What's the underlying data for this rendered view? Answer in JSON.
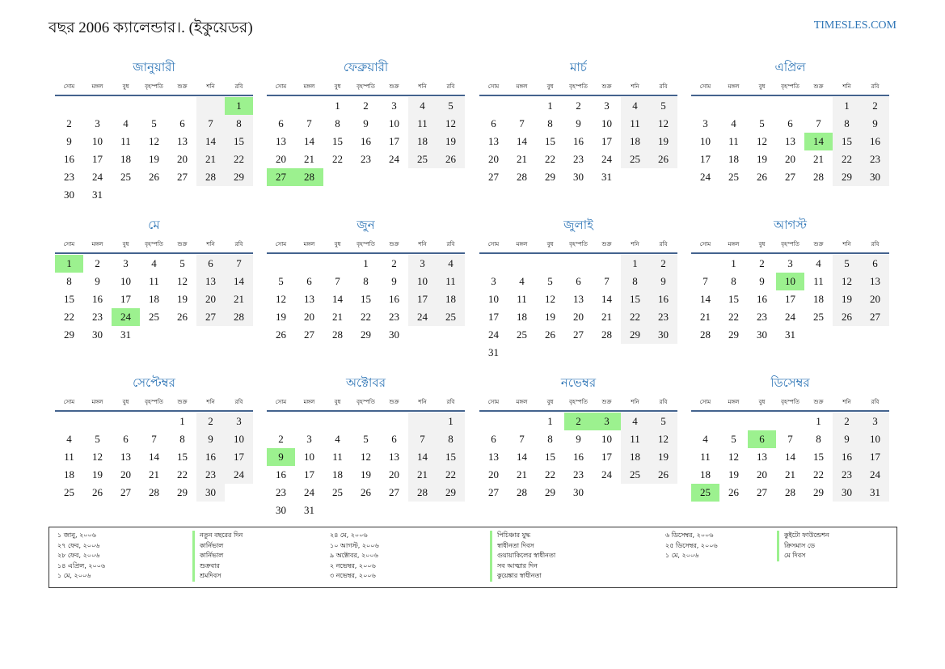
{
  "header": {
    "title": "বছর 2006 ক্যালেন্ডার।. (ইকুয়েডর)",
    "site": "TIMESLES.COM"
  },
  "weekdays": [
    "সোম",
    "মঙ্গল",
    "বুধ",
    "বৃহস্পতি",
    "শুক্র",
    "শনি",
    "রবি"
  ],
  "colors": {
    "accent": "#2e75b6",
    "holiday": "#9cf18f",
    "weekend": "#f2f2f2"
  },
  "months": [
    {
      "name": "জানুয়ারী",
      "offset": 6,
      "days": 31,
      "holidays": [
        1
      ]
    },
    {
      "name": "ফেব্রুয়ারী",
      "offset": 2,
      "days": 28,
      "holidays": [
        27,
        28
      ]
    },
    {
      "name": "মার্চ",
      "offset": 2,
      "days": 31,
      "holidays": []
    },
    {
      "name": "এপ্রিল",
      "offset": 5,
      "days": 30,
      "holidays": [
        14
      ]
    },
    {
      "name": "মে",
      "offset": 0,
      "days": 31,
      "holidays": [
        1,
        24
      ]
    },
    {
      "name": "জুন",
      "offset": 3,
      "days": 30,
      "holidays": []
    },
    {
      "name": "জুলাই",
      "offset": 5,
      "days": 31,
      "holidays": []
    },
    {
      "name": "আগস্ট",
      "offset": 1,
      "days": 31,
      "holidays": [
        10
      ]
    },
    {
      "name": "সেপ্টেম্বর",
      "offset": 4,
      "days": 30,
      "holidays": []
    },
    {
      "name": "অক্টোবর",
      "offset": 6,
      "days": 31,
      "holidays": [
        9
      ]
    },
    {
      "name": "নভেম্বর",
      "offset": 2,
      "days": 30,
      "holidays": [
        2,
        3
      ]
    },
    {
      "name": "ডিসেম্বর",
      "offset": 4,
      "days": 31,
      "holidays": [
        6,
        25
      ]
    }
  ],
  "legend": [
    [
      {
        "date": "১ জানু, ২০০৬",
        "name": "নতুন বছরের দিন"
      },
      {
        "date": "২৭ ফেব, ২০০৬",
        "name": "কার্নিভাল"
      },
      {
        "date": "২৮ ফেব, ২০০৬",
        "name": "কার্নিভাল"
      },
      {
        "date": "১৪ এপ্রিল, ২০০৬",
        "name": "শুক্রবার"
      },
      {
        "date": "১ মে, ২০০৬",
        "name": "শ্রমদিবস"
      }
    ],
    [
      {
        "date": "২৪ মে, ২০০৬",
        "name": "পিচিঞ্চার যুদ্ধ"
      },
      {
        "date": "১০ আগস্ট, ২০০৬",
        "name": "স্বাধীনতা দিবস"
      },
      {
        "date": "৯ অক্টোবর, ২০০৬",
        "name": "গুয়ায়াকিলের স্বাধীনতা"
      },
      {
        "date": "২ নভেম্বর, ২০০৬",
        "name": "সব আত্মার দিন"
      },
      {
        "date": "৩ নভেম্বর, ২০০৬",
        "name": "কুয়েঙ্কার স্বাধীনতা"
      }
    ],
    [
      {
        "date": "৬ ডিসেম্বর, ২০০৬",
        "name": "কুইটো ফাউন্ডেশন"
      },
      {
        "date": "২৫ ডিসেম্বর, ২০০৬",
        "name": "ক্রিসমাস ডে"
      },
      {
        "date": "১ মে, ২০০৬",
        "name": "মে দিবস"
      }
    ]
  ]
}
